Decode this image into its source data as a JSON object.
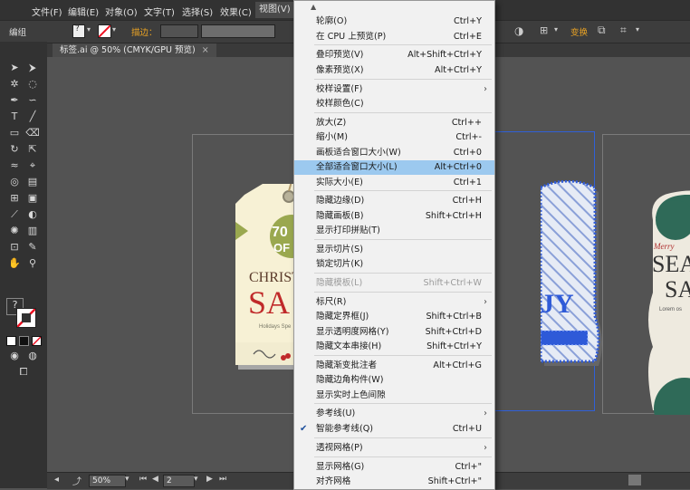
{
  "menubar": {
    "items": [
      "文件(F)",
      "编辑(E)",
      "对象(O)",
      "文字(T)",
      "选择(S)",
      "效果(C)",
      "视图(V)"
    ],
    "active": "视图(V)"
  },
  "controlbar": {
    "mode_label": "编组",
    "stroke_label": "描边：",
    "transform_label": "变换"
  },
  "document": {
    "tab_title": "标签.ai @ 50% (CMYK/GPU 预览)"
  },
  "artwork": {
    "tag1_percent": "70",
    "tag1_of": "OF",
    "tag1_heading": "CHRIST",
    "tag1_sale": "SA",
    "tag1_small": "Holidays Spe",
    "tag2_letters": "JY",
    "tag3_merry": "Merry",
    "tag3_big1": "SEA",
    "tag3_big2": "SA",
    "tag3_small": "Lorem os"
  },
  "status": {
    "zoom": "50%",
    "artboard": "2"
  },
  "view_menu": {
    "items": [
      {
        "label": "轮廓(O)",
        "shortcut": "Ctrl+Y"
      },
      {
        "label": "在 CPU 上预览(P)",
        "shortcut": "Ctrl+E"
      },
      {
        "label": "叠印预览(V)",
        "shortcut": "Alt+Shift+Ctrl+Y"
      },
      {
        "label": "像素预览(X)",
        "shortcut": "Alt+Ctrl+Y"
      },
      {
        "label": "校样设置(F)",
        "shortcut": ""
      },
      {
        "label": "校样颜色(C)",
        "shortcut": ""
      },
      {
        "label": "放大(Z)",
        "shortcut": "Ctrl++"
      },
      {
        "label": "缩小(M)",
        "shortcut": "Ctrl+-"
      },
      {
        "label": "画板适合窗口大小(W)",
        "shortcut": "Ctrl+0"
      },
      {
        "label": "全部适合窗口大小(L)",
        "shortcut": "Alt+Ctrl+0"
      },
      {
        "label": "实际大小(E)",
        "shortcut": "Ctrl+1"
      },
      {
        "label": "隐藏边缘(D)",
        "shortcut": "Ctrl+H"
      },
      {
        "label": "隐藏画板(B)",
        "shortcut": "Shift+Ctrl+H"
      },
      {
        "label": "显示打印拼贴(T)",
        "shortcut": ""
      },
      {
        "label": "显示切片(S)",
        "shortcut": ""
      },
      {
        "label": "锁定切片(K)",
        "shortcut": ""
      },
      {
        "label": "隐藏模板(L)",
        "shortcut": "Shift+Ctrl+W"
      },
      {
        "label": "标尺(R)",
        "shortcut": ""
      },
      {
        "label": "隐藏定界框(J)",
        "shortcut": "Shift+Ctrl+B"
      },
      {
        "label": "显示透明度网格(Y)",
        "shortcut": "Shift+Ctrl+D"
      },
      {
        "label": "隐藏文本串接(H)",
        "shortcut": "Shift+Ctrl+Y"
      },
      {
        "label": "隐藏渐变批注者",
        "shortcut": "Alt+Ctrl+G"
      },
      {
        "label": "隐藏边角构件(W)",
        "shortcut": ""
      },
      {
        "label": "显示实时上色间隙",
        "shortcut": ""
      },
      {
        "label": "参考线(U)",
        "shortcut": ""
      },
      {
        "label": "智能参考线(Q)",
        "shortcut": "Ctrl+U"
      },
      {
        "label": "透视网格(P)",
        "shortcut": ""
      },
      {
        "label": "显示网格(G)",
        "shortcut": "Ctrl+\""
      },
      {
        "label": "对齐网格",
        "shortcut": "Shift+Ctrl+\""
      }
    ]
  }
}
